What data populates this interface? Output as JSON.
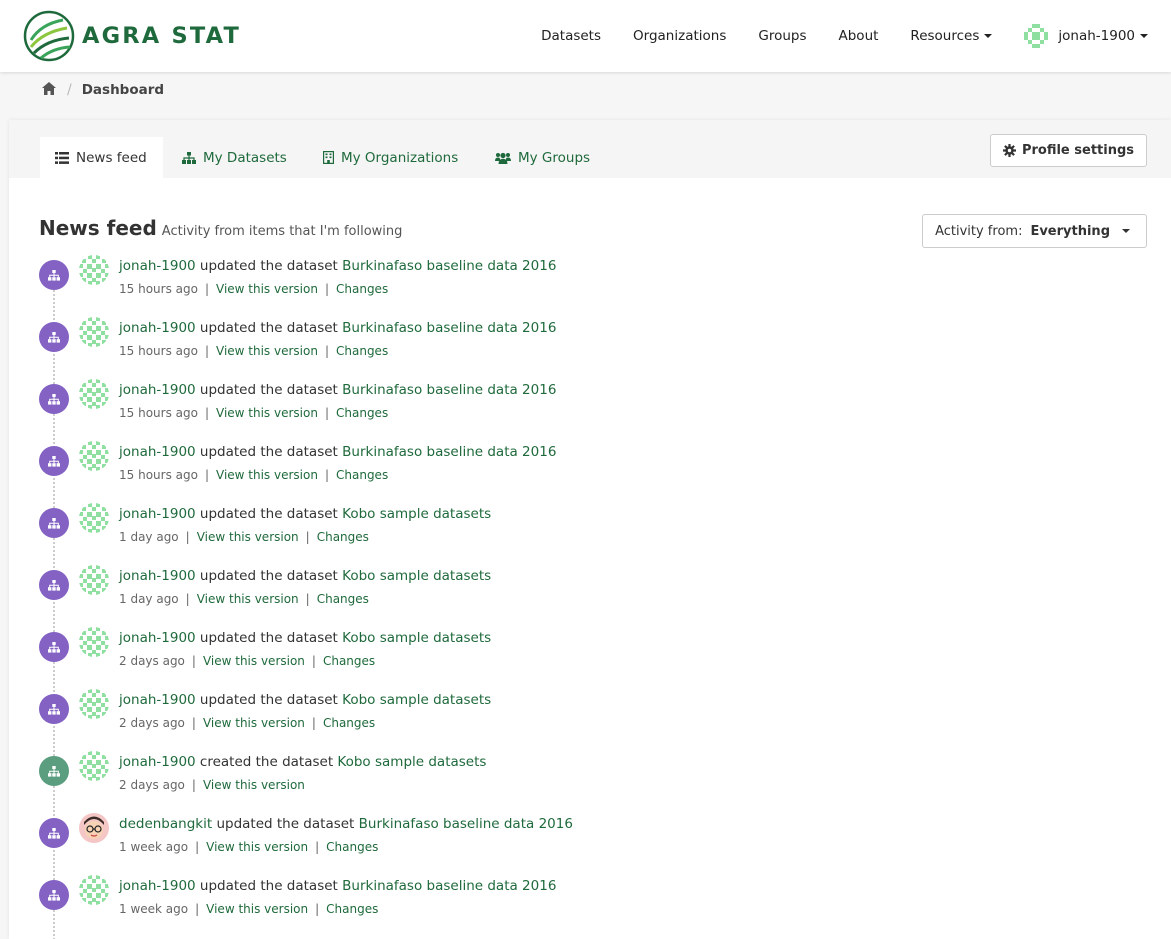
{
  "brand": {
    "name": "AGRA STAT",
    "color": "#1f6a3c"
  },
  "nav": {
    "items": [
      "Datasets",
      "Organizations",
      "Groups",
      "About"
    ],
    "resources": "Resources",
    "user": "jonah-1900"
  },
  "breadcrumb": {
    "current": "Dashboard"
  },
  "tabs": [
    "News feed",
    "My Datasets",
    "My Organizations",
    "My Groups"
  ],
  "profile_settings": "Profile settings",
  "feed": {
    "title": "News feed",
    "subtitle": "Activity from items that I'm following",
    "filter_label": "Activity from:",
    "filter_value": "Everything"
  },
  "activities": [
    {
      "user": "jonah-1900",
      "action": "updated the dataset",
      "dataset": "Burkinafaso baseline data 2016",
      "time": "15 hours ago",
      "view": "View this version",
      "changes": "Changes"
    },
    {
      "user": "jonah-1900",
      "action": "updated the dataset",
      "dataset": "Burkinafaso baseline data 2016",
      "time": "15 hours ago",
      "view": "View this version",
      "changes": "Changes"
    },
    {
      "user": "jonah-1900",
      "action": "updated the dataset",
      "dataset": "Burkinafaso baseline data 2016",
      "time": "15 hours ago",
      "view": "View this version",
      "changes": "Changes"
    },
    {
      "user": "jonah-1900",
      "action": "updated the dataset",
      "dataset": "Burkinafaso baseline data 2016",
      "time": "15 hours ago",
      "view": "View this version",
      "changes": "Changes"
    },
    {
      "user": "jonah-1900",
      "action": "updated the dataset",
      "dataset": "Kobo sample datasets",
      "time": "1 day ago",
      "view": "View this version",
      "changes": "Changes"
    },
    {
      "user": "jonah-1900",
      "action": "updated the dataset",
      "dataset": "Kobo sample datasets",
      "time": "1 day ago",
      "view": "View this version",
      "changes": "Changes"
    },
    {
      "user": "jonah-1900",
      "action": "updated the dataset",
      "dataset": "Kobo sample datasets",
      "time": "2 days ago",
      "view": "View this version",
      "changes": "Changes"
    },
    {
      "user": "jonah-1900",
      "action": "updated the dataset",
      "dataset": "Kobo sample datasets",
      "time": "2 days ago",
      "view": "View this version",
      "changes": "Changes"
    },
    {
      "user": "jonah-1900",
      "action": "created the dataset",
      "dataset": "Kobo sample datasets",
      "time": "2 days ago",
      "view": "View this version",
      "changes": ""
    },
    {
      "user": "dedenbangkit",
      "action": "updated the dataset",
      "dataset": "Burkinafaso baseline data 2016",
      "time": "1 week ago",
      "view": "View this version",
      "changes": "Changes"
    },
    {
      "user": "jonah-1900",
      "action": "updated the dataset",
      "dataset": "Burkinafaso baseline data 2016",
      "time": "1 week ago",
      "view": "View this version",
      "changes": "Changes"
    }
  ]
}
